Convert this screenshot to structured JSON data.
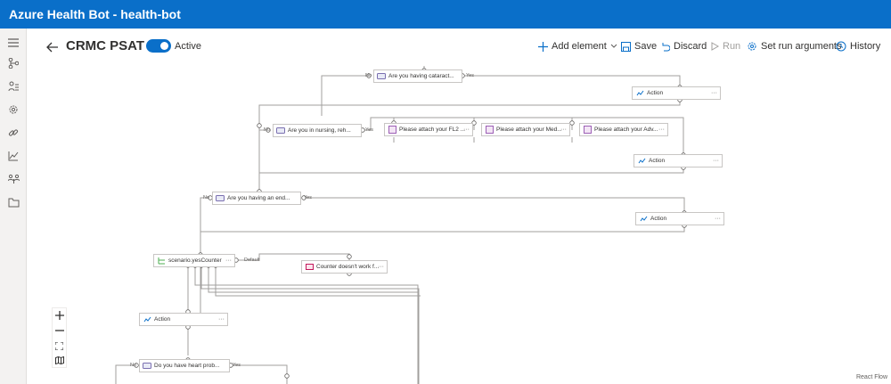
{
  "app": {
    "title": "Azure Health Bot - health-bot"
  },
  "nav": {
    "items": [
      {
        "icon": "hamburger-icon"
      },
      {
        "icon": "flow-icon"
      },
      {
        "icon": "scenario-icon"
      },
      {
        "icon": "gear-icon"
      },
      {
        "icon": "link-icon"
      },
      {
        "icon": "analytics-icon"
      },
      {
        "icon": "users-icon"
      },
      {
        "icon": "folder-icon"
      }
    ]
  },
  "header": {
    "title": "CRMC PSAT",
    "active_label": "Active",
    "active": true
  },
  "toolbar": {
    "add_element": "Add element",
    "save": "Save",
    "discard": "Discard",
    "run": "Run",
    "set_run_arguments": "Set run arguments",
    "history": "History"
  },
  "flow": {
    "nodes": {
      "q_cataract": "Are you having cataract...",
      "action1": "Action",
      "q_nursing": "Are you in nursing, reh...",
      "attach_fl2": "Please attach your FL2 ...",
      "attach_med": "Please attach your Med...",
      "attach_adv": "Please attach your Adv...",
      "action2": "Action",
      "q_end": "Are you having an end...",
      "action3": "Action",
      "switch": "scenario.yesCounter",
      "counter": "Counter doesn't work f...",
      "action4": "Action",
      "q_heart": "Do you have heart prob..."
    },
    "labels": {
      "no": "No",
      "yes": "Yes",
      "default": "Default",
      "more": "···"
    }
  },
  "footer": {
    "brand": "React Flow"
  },
  "colors": {
    "brand": "#0a6fc9",
    "edge": "#a19f9d"
  }
}
